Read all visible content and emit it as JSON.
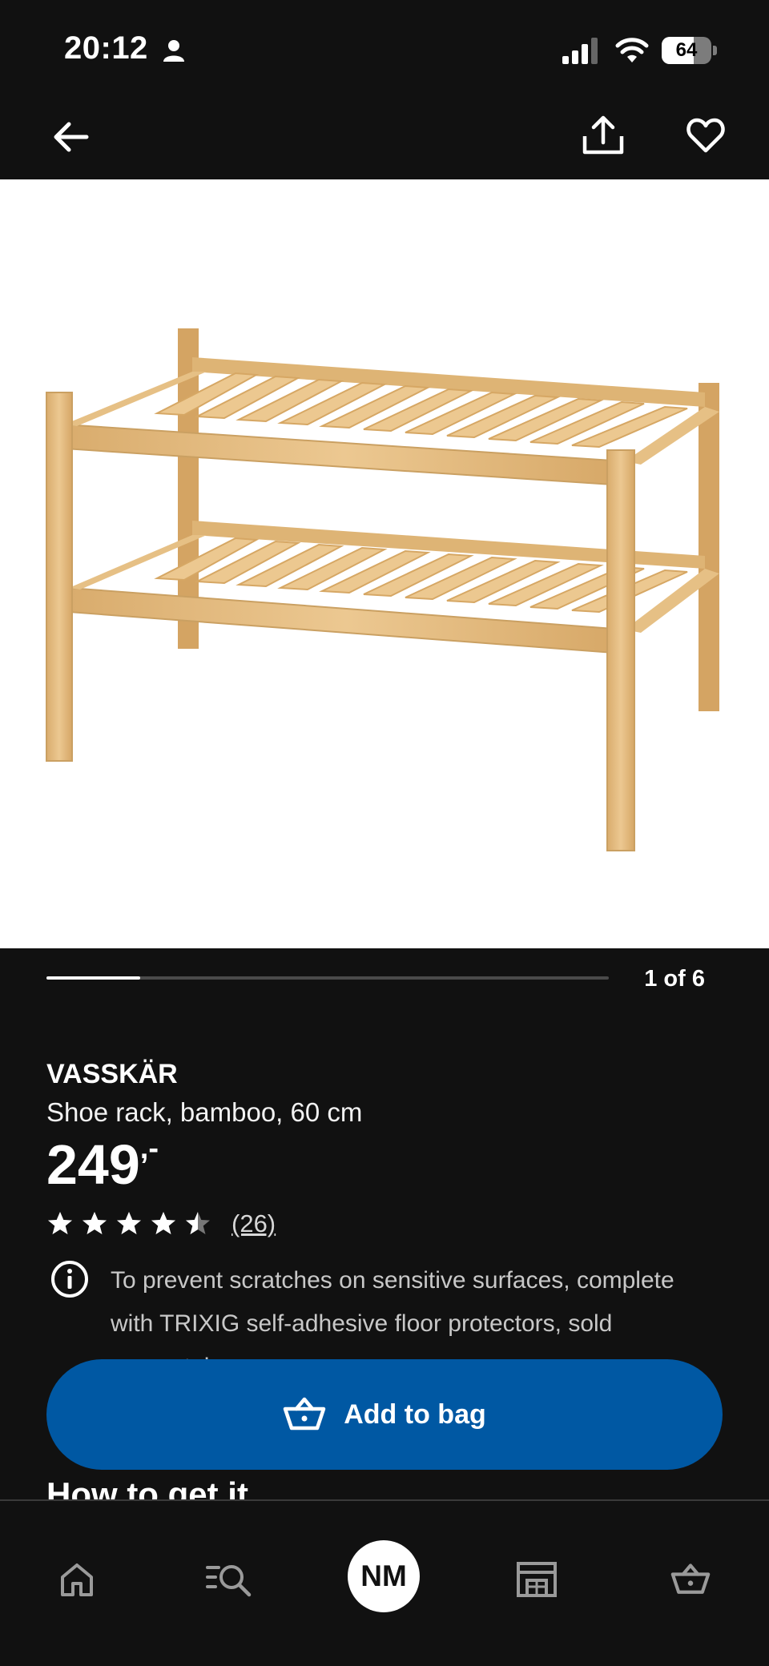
{
  "status_bar": {
    "time": "20:12",
    "battery_level": "64",
    "battery_fraction": 0.64,
    "icons": [
      "person-icon",
      "signal-icon",
      "wifi-icon",
      "battery-icon"
    ]
  },
  "top_bar": {
    "icons": [
      "back-arrow-icon",
      "share-icon",
      "heart-icon"
    ]
  },
  "product_image": {
    "subject": "bamboo shoe rack"
  },
  "pager": {
    "label": "1 of 6",
    "current": 1,
    "total": 6
  },
  "product": {
    "name": "VASSKÄR",
    "description": "Shoe rack, bamboo, 60 cm",
    "price": "249",
    "price_suffix": ",-",
    "rating": 4.5,
    "rating_max": 5,
    "review_count": "(26)"
  },
  "notice": {
    "icon": "info-icon",
    "text": "To prevent scratches on sensitive surfaces, complete with TRIXIG self-adhesive floor protectors, sold separately."
  },
  "cta": {
    "label": "Add to bag",
    "icon": "basket-icon"
  },
  "section": {
    "how_to_get_it": "How to get it"
  },
  "bottom_nav": {
    "profile_initials": "NM",
    "icons": [
      "home-icon",
      "search-list-icon",
      "profile-avatar",
      "store-icon",
      "basket-icon"
    ]
  },
  "colors": {
    "background": "#111111",
    "accent_blue": "#0058a3",
    "wood": "#e3bd84"
  }
}
